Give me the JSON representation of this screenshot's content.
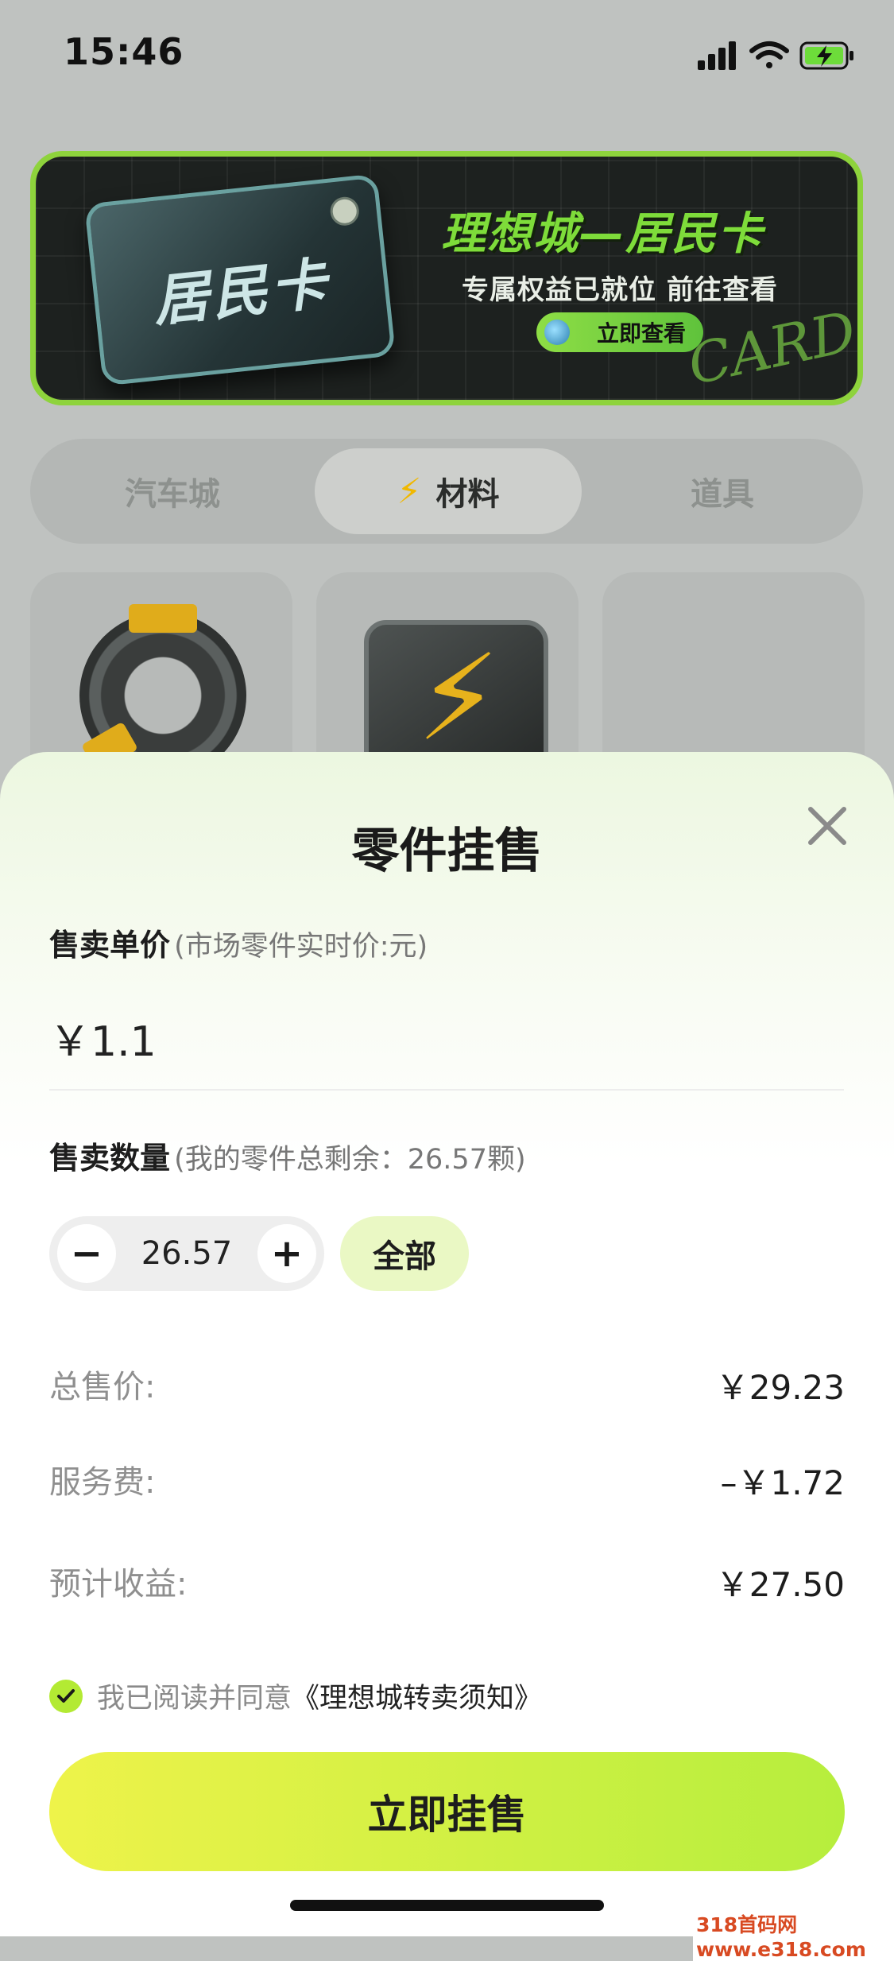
{
  "status_bar": {
    "time": "15:46",
    "icons": [
      "signal-icon",
      "wifi-icon",
      "battery-charging-icon"
    ]
  },
  "banner": {
    "card_label": "居民卡",
    "title": "理想城—居民卡",
    "subtitle": "专属权益已就位 前往查看",
    "button_label": "立即查看",
    "deco_text": "CARD"
  },
  "category_tabs": {
    "items": [
      {
        "label": "汽车城"
      },
      {
        "label": "材料",
        "icon": "lightning-icon",
        "active": true
      },
      {
        "label": "道具"
      }
    ]
  },
  "sheet": {
    "title": "零件挂售",
    "unit_price": {
      "label": "售卖单价",
      "hint": "(市场零件实时价:元)",
      "value": "￥1.1"
    },
    "quantity": {
      "label": "售卖数量",
      "hint": "(我的零件总剩余：26.57颗)",
      "value": "26.57",
      "minus": "−",
      "plus": "+",
      "all_label": "全部"
    },
    "summary": [
      {
        "label": "总售价:",
        "value": "￥29.23"
      },
      {
        "label": "服务费:",
        "value": "–￥1.72"
      },
      {
        "label": "预计收益:",
        "value": "￥27.50"
      }
    ],
    "agreement": {
      "checked": true,
      "text": "我已阅读并同意",
      "link": "《理想城转卖须知》"
    },
    "submit_label": "立即挂售"
  },
  "watermark": "318首码网 www.e318.com",
  "colors": {
    "accent_green": "#b6ee3d",
    "accent_yellow": "#eef34a",
    "check_green": "#b3ea33"
  }
}
